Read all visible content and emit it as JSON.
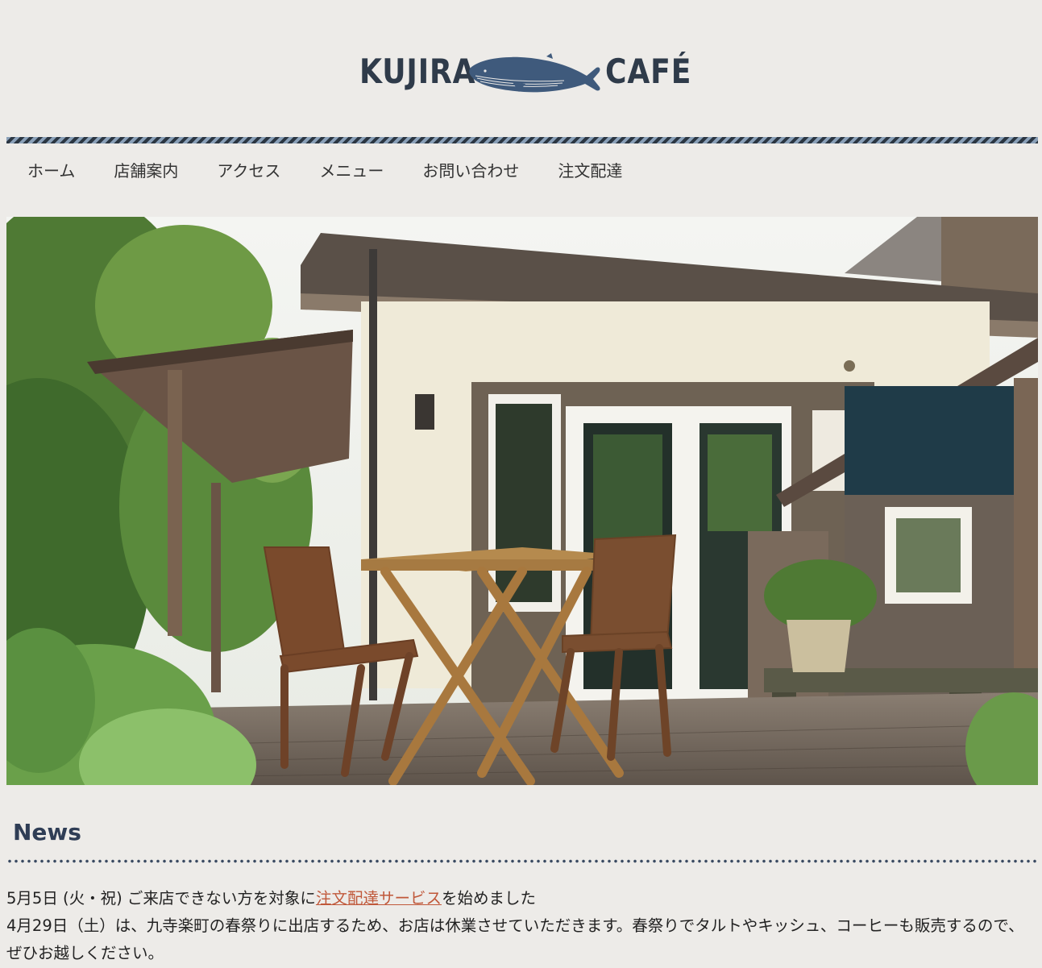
{
  "logo": {
    "left_text": "KUJIRA",
    "right_text": "CAFÉ"
  },
  "nav": [
    "ホーム",
    "店舗案内",
    "アクセス",
    "メニュー",
    "お問い合わせ",
    "注文配達"
  ],
  "news": {
    "title": "News",
    "item1_before": "5月5日 (火・祝) ご来店できない方を対象に",
    "item1_link": "注文配達サービス",
    "item1_after": "を始めました",
    "item2": "4月29日（土）は、九寺楽町の春祭りに出店するため、お店は休業させていただきます。春祭りでタルトやキッシュ、コーヒーも販売するので、ぜひお越しください。"
  },
  "colors": {
    "brand": "#2f3b4a",
    "whale": "#3f5a7c",
    "link": "#c0583a",
    "background": "#edebe8"
  }
}
